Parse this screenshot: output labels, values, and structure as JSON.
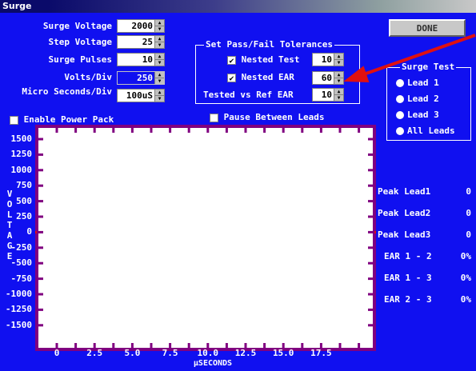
{
  "window": {
    "title": "Surge"
  },
  "done_label": "DONE",
  "settings": {
    "surge_voltage": {
      "label": "Surge Voltage",
      "value": "2000"
    },
    "step_voltage": {
      "label": "Step Voltage",
      "value": "25"
    },
    "surge_pulses": {
      "label": "Surge Pulses",
      "value": "10"
    },
    "volts_div": {
      "label": "Volts/Div",
      "value": "250"
    },
    "micro_sec_div": {
      "label": "Micro Seconds/Div",
      "value": "100uS"
    }
  },
  "tolerances": {
    "title": "Set Pass/Fail Tolerances",
    "nested_test": {
      "label": "Nested Test",
      "value": "10",
      "checked": "✔"
    },
    "nested_ear": {
      "label": "Nested EAR",
      "value": "60",
      "checked": "✔"
    },
    "tested_vs_ref": {
      "label": "Tested vs Ref EAR",
      "value": "10"
    }
  },
  "surge_test": {
    "title": "Surge Test",
    "options": [
      "Lead 1",
      "Lead 2",
      "Lead 3",
      "All Leads"
    ]
  },
  "enable_power_pack": "Enable Power Pack",
  "pause_between_leads": "Pause Between Leads",
  "chart_data": {
    "type": "line",
    "ylabel": "VOLTAGE",
    "xlabel": "µSECONDS",
    "y_ticks": [
      "1500",
      "1250",
      "1000",
      "750",
      "500",
      "250",
      "0",
      "-250",
      "-500",
      "-750",
      "-1000",
      "-1250",
      "-1500"
    ],
    "x_ticks": [
      "0",
      "2.5",
      "5.0",
      "7.5",
      "10.0",
      "12.5",
      "15.0",
      "17.5"
    ],
    "series": []
  },
  "readouts": [
    {
      "label": "Peak Lead1",
      "value": "0"
    },
    {
      "label": "Peak Lead2",
      "value": "0"
    },
    {
      "label": "Peak Lead3",
      "value": "0"
    },
    {
      "label": "EAR 1 - 2",
      "value": "0%"
    },
    {
      "label": "EAR 1 - 3",
      "value": "0%"
    },
    {
      "label": "EAR 2 - 3",
      "value": "0%"
    }
  ],
  "colors": {
    "background": "#1010f0",
    "plot_border": "#800080",
    "arrow": "#e01010"
  }
}
